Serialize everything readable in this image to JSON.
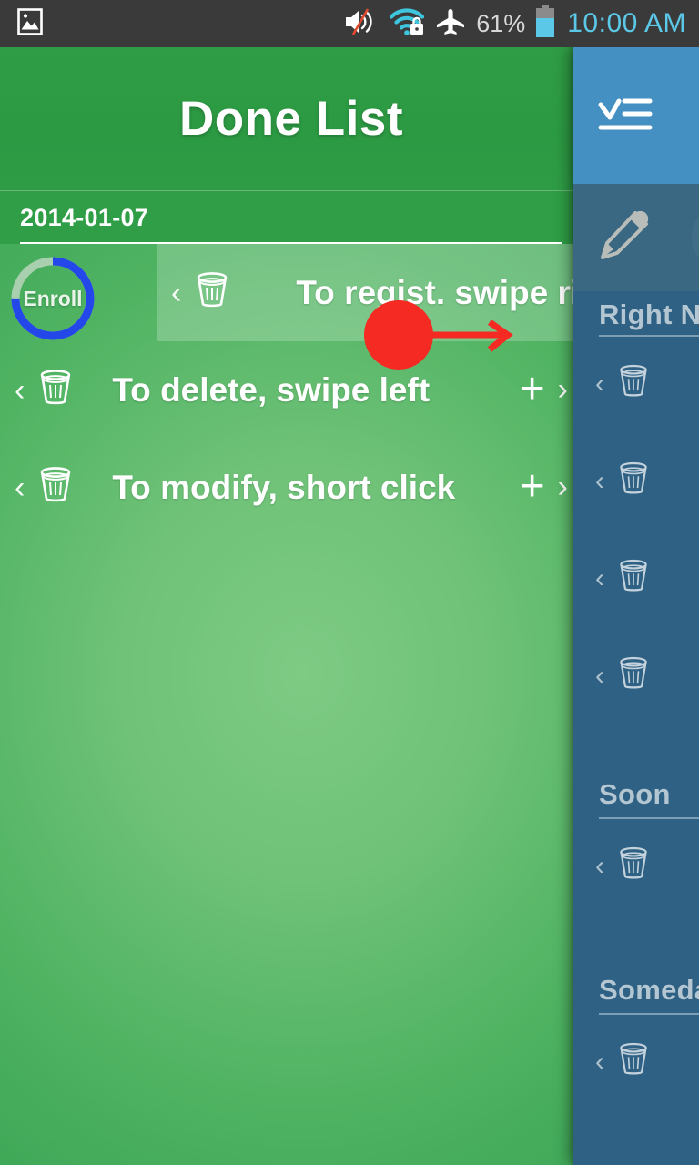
{
  "status_bar": {
    "left_icons": [
      {
        "name": "gallery-image-icon"
      }
    ],
    "right_icons": [
      {
        "name": "volume-muted-icon"
      },
      {
        "name": "wifi-secured-icon"
      },
      {
        "name": "airplane-mode-icon"
      }
    ],
    "battery_percent": "61%",
    "battery_icon": "battery-icon",
    "clock": "10:00 AM",
    "colors": {
      "background": "#3a3a3a",
      "clock": "#5bc8e8",
      "battery_fill": "#5bc8e8"
    }
  },
  "app": {
    "title": "Done List",
    "colors": {
      "title_bar": "#2e9c45",
      "background_green_light": "#7ecb84",
      "background_green_dark": "#36a252",
      "accent_blue": "#2347e8",
      "gesture_red": "#f42a23",
      "drawer_header_blue": "#4490c2",
      "drawer_body_blue": "#2e6183"
    }
  },
  "date_header": {
    "date": "2014-01-07"
  },
  "enroll": {
    "label": "Enroll",
    "progress_percent": 75,
    "ring_color": "#2347e8",
    "track_color": "#a8cfae"
  },
  "list": {
    "items": [
      {
        "chevron_left": "‹",
        "icon": "trash-icon",
        "text": "To regist. swipe right",
        "swiped": true,
        "plus": "",
        "chevron_right": ""
      },
      {
        "chevron_left": "‹",
        "icon": "trash-icon",
        "text": "To delete, swipe left",
        "swiped": false,
        "plus": "+",
        "chevron_right": "›"
      },
      {
        "chevron_left": "‹",
        "icon": "trash-icon",
        "text": "To modify, short click",
        "swiped": false,
        "plus": "+",
        "chevron_right": "›"
      }
    ]
  },
  "gesture_hint": {
    "type": "swipe-right",
    "dot_color": "#f42a23",
    "arrow_color": "#f42a23"
  },
  "drawer": {
    "header_icon": "checklist-icon",
    "action_icons": [
      {
        "name": "pencil-edit-icon"
      },
      {
        "name": "drawer-action-circle-button"
      }
    ],
    "sections": [
      {
        "title": "Right Now",
        "rows": [
          {
            "chevron_left": "‹",
            "icon": "trash-icon",
            "text": ""
          },
          {
            "chevron_left": "‹",
            "icon": "trash-icon",
            "text": ""
          },
          {
            "chevron_left": "‹",
            "icon": "trash-icon",
            "text": ""
          },
          {
            "chevron_left": "‹",
            "icon": "trash-icon",
            "text": ""
          }
        ]
      },
      {
        "title": "Soon",
        "rows": [
          {
            "chevron_left": "‹",
            "icon": "trash-icon",
            "text": ""
          }
        ]
      },
      {
        "title": "Someday",
        "rows": [
          {
            "chevron_left": "‹",
            "icon": "trash-icon",
            "text": ""
          }
        ]
      }
    ]
  }
}
